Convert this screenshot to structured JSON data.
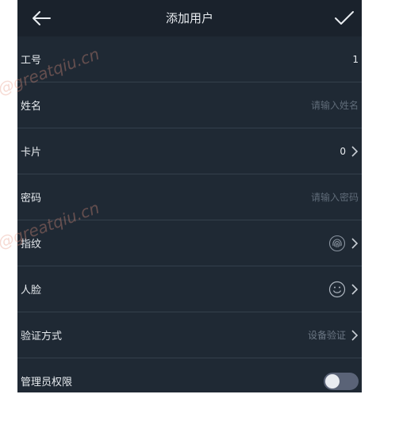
{
  "header": {
    "title": "添加用户",
    "back_icon": "back-arrow-icon",
    "confirm_icon": "check-icon"
  },
  "rows": [
    {
      "label": "工号",
      "value": "1"
    },
    {
      "label": "姓名",
      "placeholder": "请输入姓名"
    },
    {
      "label": "卡片",
      "value": "0"
    },
    {
      "label": "密码",
      "placeholder": "请输入密码"
    },
    {
      "label": "指纹",
      "icon": "fingerprint-icon"
    },
    {
      "label": "人脸",
      "icon": "smiley-face-icon"
    },
    {
      "label": "验证方式",
      "value": "设备验证"
    },
    {
      "label": "管理员权限",
      "toggle_on": false
    }
  ],
  "watermark": "@greatqiu.cn",
  "colors": {
    "background": "#1f2934",
    "topbar": "#1a222c",
    "divider": "#34404c",
    "toggle_off": "#5a6377"
  }
}
